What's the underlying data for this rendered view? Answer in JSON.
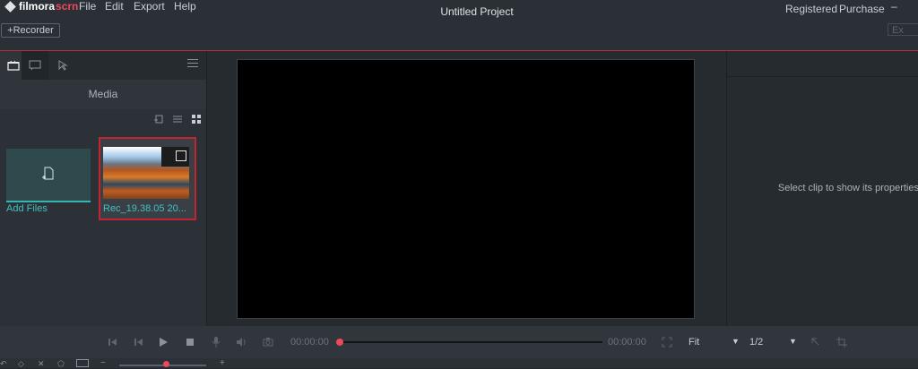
{
  "app": {
    "logo_word1": "filmora",
    "logo_word2": "scrn",
    "title": "Untitled Project"
  },
  "menu": {
    "file": "File",
    "edit": "Edit",
    "export": "Export",
    "help": "Help"
  },
  "header": {
    "registered": "Registered",
    "purchase": "Purchase",
    "minimize": "–"
  },
  "toolbar": {
    "recorder_label": "+Recorder",
    "export_label": "Ex"
  },
  "left_panel": {
    "tab_label": "Media",
    "tabs": [
      "media-tab",
      "text-tab",
      "cursor-tab"
    ],
    "add_files_label": "Add Files",
    "clip_label": "Rec_19.38.05 20..."
  },
  "right_panel": {
    "properties_hint": "Select clip to show its properties"
  },
  "playback": {
    "time_current": "00:00:00",
    "time_total": "00:00:00",
    "fit_option": "Fit",
    "ratio_option": "1/2",
    "progress": 0
  },
  "timeline": {
    "zoom_minus": "−",
    "zoom_plus": "+"
  },
  "colors": {
    "accent": "#f0475c",
    "teal": "#43c0c0",
    "background": "#24292e"
  }
}
